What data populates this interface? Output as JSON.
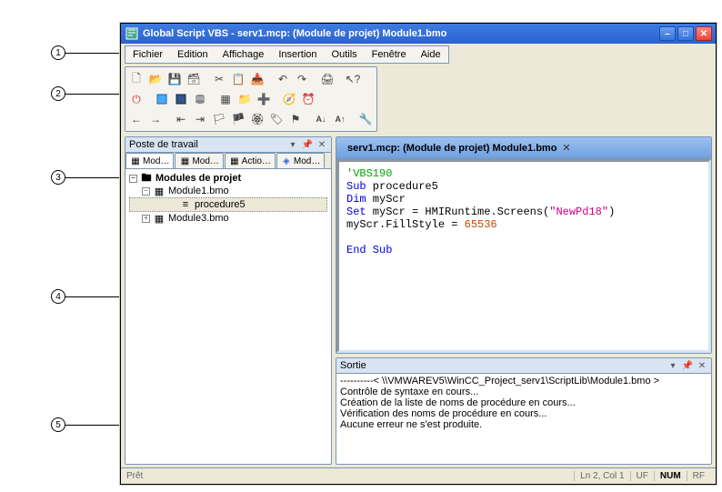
{
  "title": "Global Script VBS - serv1.mcp: (Module de projet) Module1.bmo",
  "menu": [
    "Fichier",
    "Edition",
    "Affichage",
    "Insertion",
    "Outils",
    "Fenêtre",
    "Aide"
  ],
  "toolbar_icons": {
    "row1": [
      "file-new",
      "file-open",
      "file-save",
      "save-all",
      "blank",
      "cut",
      "copy",
      "paste",
      "blank",
      "undo",
      "redo",
      "blank",
      "print",
      "blank",
      "help-cursor"
    ],
    "row2": [
      "exit",
      "blank",
      "box-blue",
      "box-dark",
      "db",
      "blank",
      "table",
      "box-y",
      "box-plus",
      "blank",
      "compass",
      "clock"
    ],
    "row3": [
      "arrow-left",
      "arrow-right",
      "blank",
      "outdent",
      "indent",
      "flag-a",
      "flag-b",
      "flag-c",
      "flag-d",
      "flag-e",
      "blank",
      "ab1",
      "ab2",
      "blank",
      "wrench"
    ]
  },
  "workspace": {
    "panel_title": "Poste de travail",
    "tabs": [
      "Mod…",
      "Mod…",
      "Actio…",
      "Mod…"
    ],
    "tree": {
      "root": "Modules de projet",
      "items": [
        {
          "name": "Module1.bmo",
          "expanded": true,
          "proc": "procedure5"
        },
        {
          "name": "Module3.bmo",
          "expanded": false
        }
      ]
    }
  },
  "editor": {
    "tab_label": "serv1.mcp: (Module de projet) Module1.bmo",
    "code": {
      "l1": "'VBS190",
      "l2a": "Sub",
      "l2b": " procedure5",
      "l3a": "Dim",
      "l3b": " myScr",
      "l4a": "Set",
      "l4b": " myScr = HMIRuntime.Screens(",
      "l4c": "\"NewPd18\"",
      "l4d": ")",
      "l5a": "myScr.FillStyle = ",
      "l5b": "65536",
      "l6": "End Sub"
    }
  },
  "output": {
    "title": "Sortie",
    "lines": [
      "----------< \\\\VMWAREV5\\WinCC_Project_serv1\\ScriptLib\\Module1.bmo >",
      "Contrôle de syntaxe en cours...",
      "Création de la liste de noms de procédure en cours...",
      "Vérification des noms de procédure en cours...",
      "Aucune erreur ne s'est produite."
    ]
  },
  "statusbar": {
    "ready": "Prêt",
    "pos": "Ln 2, Col 1",
    "uf": "UF",
    "num": "NUM",
    "rf": "RF"
  },
  "callouts": [
    "1",
    "2",
    "3",
    "4",
    "5"
  ]
}
